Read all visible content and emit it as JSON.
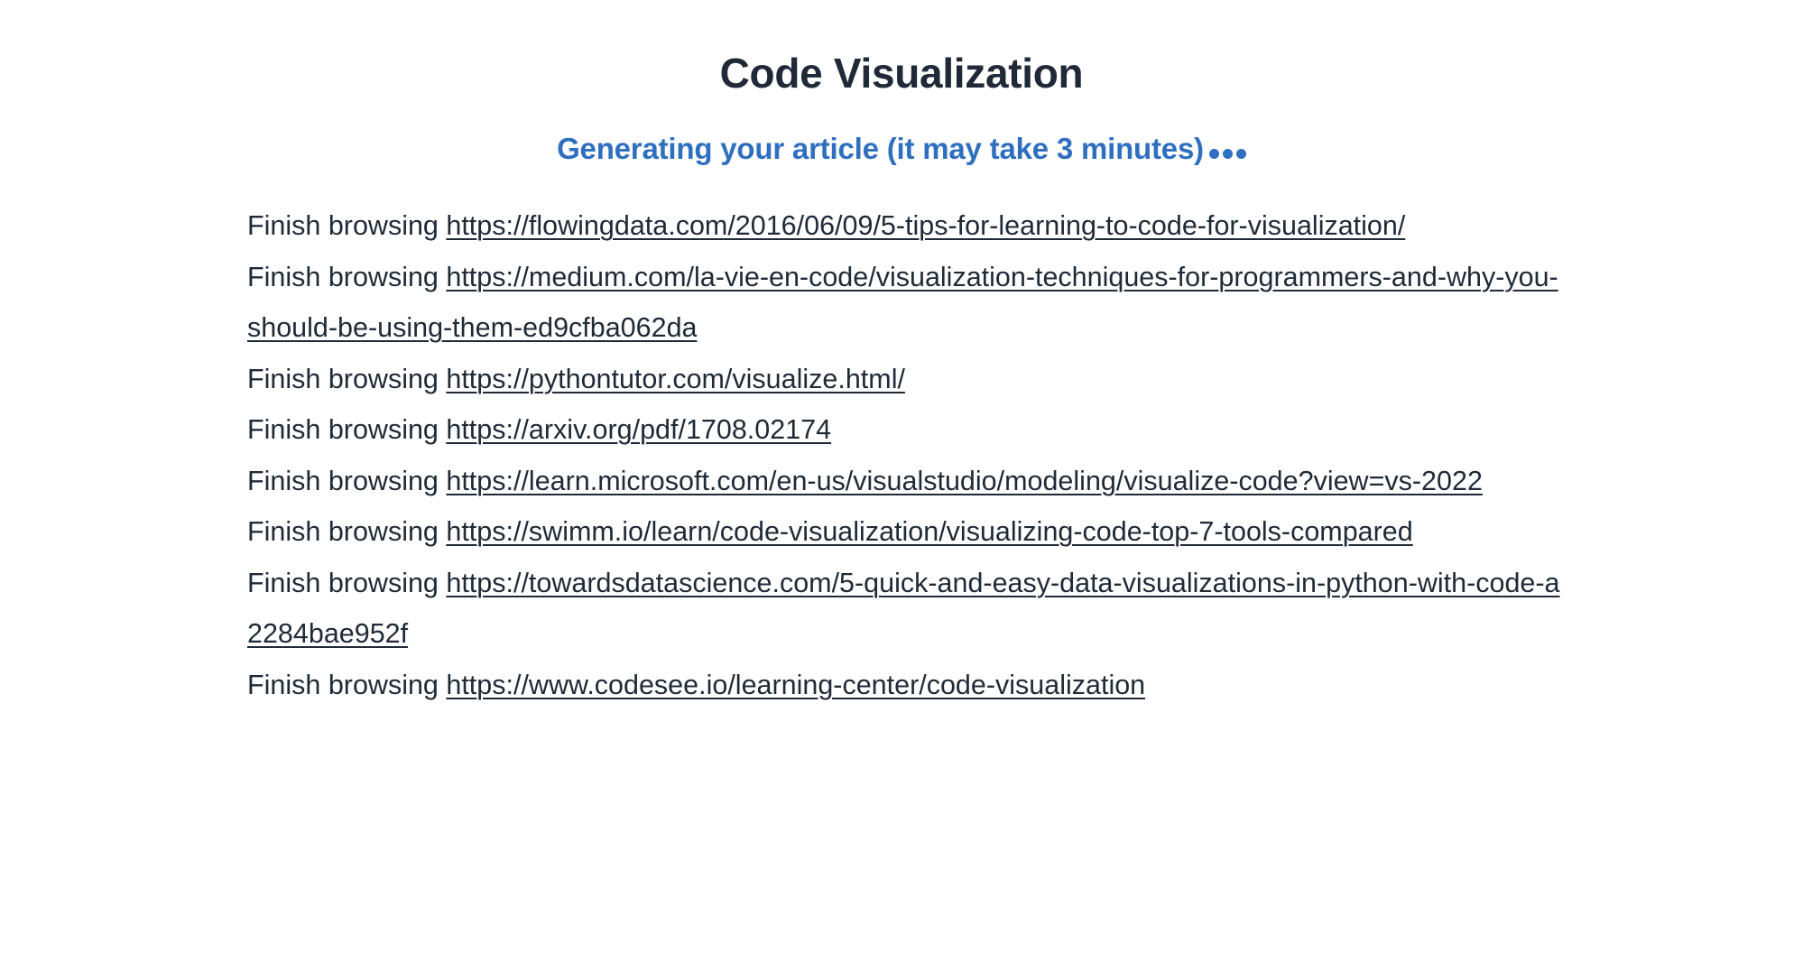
{
  "header": {
    "title": "Code Visualization"
  },
  "status": {
    "text": "Generating your article (it may take 3 minutes)",
    "dots": "•••",
    "color": "#2f6fc0"
  },
  "log": {
    "prefix": "Finish browsing ",
    "items": [
      {
        "prefix": "Finish browsing ",
        "url": "https://flowingdata.com/2016/06/09/5-tips-for-learning-to-code-for-visualization/"
      },
      {
        "prefix": "Finish browsing ",
        "url": "https://medium.com/la-vie-en-code/visualization-techniques-for-programmers-and-why-you-should-be-using-them-ed9cfba062da"
      },
      {
        "prefix": "Finish browsing ",
        "url": "https://pythontutor.com/visualize.html/"
      },
      {
        "prefix": "Finish browsing ",
        "url": "https://arxiv.org/pdf/1708.02174"
      },
      {
        "prefix": "Finish browsing ",
        "url": "https://learn.microsoft.com/en-us/visualstudio/modeling/visualize-code?view=vs-2022"
      },
      {
        "prefix": "Finish browsing ",
        "url": "https://swimm.io/learn/code-visualization/visualizing-code-top-7-tools-compared"
      },
      {
        "prefix": "Finish browsing ",
        "url": "https://towardsdatascience.com/5-quick-and-easy-data-visualizations-in-python-with-code-a2284bae952f"
      },
      {
        "prefix": "Finish browsing ",
        "url": "https://www.codesee.io/learning-center/code-visualization"
      }
    ]
  },
  "colors": {
    "text": "#1f2a37",
    "title": "#1f2937",
    "accent": "#2f6fc0",
    "background": "#ffffff"
  }
}
